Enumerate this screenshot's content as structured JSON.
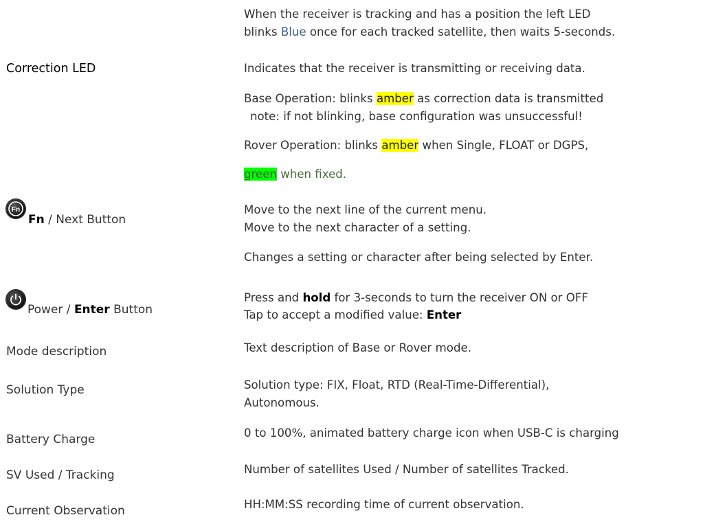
{
  "rows": {
    "status_led": {
      "line1": "When the receiver is tracking and has a position the left LED",
      "line2_pre": "blinks ",
      "line2_blue": "Blue",
      "line2_post": " once for each tracked satellite, then waits 5-seconds."
    },
    "correction_led": {
      "label": "Correction LED",
      "desc": "Indicates that the receiver is transmitting or receiving data.",
      "base_pre": "Base Operation: blinks ",
      "base_amber": "amber",
      "base_post": " as correction data is transmitted",
      "base_note": "note: if not blinking, base configuration was unsuccessful!",
      "rover_pre": "Rover Operation: blinks ",
      "rover_amber": "amber",
      "rover_post": " when Single, FLOAT or DGPS,",
      "rover_green": "green",
      "rover_green_post": " when fixed."
    },
    "fn_button": {
      "icon_text": "Fn",
      "label_bold": "Fn",
      "label_rest": " / Next Button",
      "line1": "Move to the next line of the current menu.",
      "line2": "Move to the next character of a setting.",
      "line3": "Changes a setting or character after being selected by Enter."
    },
    "power_button": {
      "label_pre": "Power / ",
      "label_bold": "Enter",
      "label_post": " Button",
      "line1_pre": "Press and ",
      "line1_bold": "hold",
      "line1_post": " for 3-seconds to turn the receiver ON or OFF",
      "line2_pre": "Tap to accept a modified value: ",
      "line2_bold": "Enter"
    },
    "mode_description": {
      "label": "Mode description",
      "desc": "Text description of Base or Rover mode."
    },
    "solution_type": {
      "label": "Solution Type",
      "desc1": "Solution type: FIX, Float, RTD (Real-Time-Differential),",
      "desc2": "Autonomous."
    },
    "battery_charge": {
      "label": "Battery Charge",
      "desc": "0 to 100%, animated battery charge icon when USB-C is charging"
    },
    "sv_used": {
      "label": "SV Used / Tracking",
      "desc": "Number of satellites Used / Number of satellites Tracked."
    },
    "current_observation": {
      "label": "Current Observation",
      "desc": "HH:MM:SS recording time of current observation."
    }
  },
  "colors": {
    "blue_text": "#3b5f86",
    "amber_highlight": "#ffff00",
    "green_highlight": "#00ff00",
    "green_text": "#4a6b39"
  },
  "icons": {
    "fn": "fn-button-icon",
    "power": "power-icon"
  }
}
